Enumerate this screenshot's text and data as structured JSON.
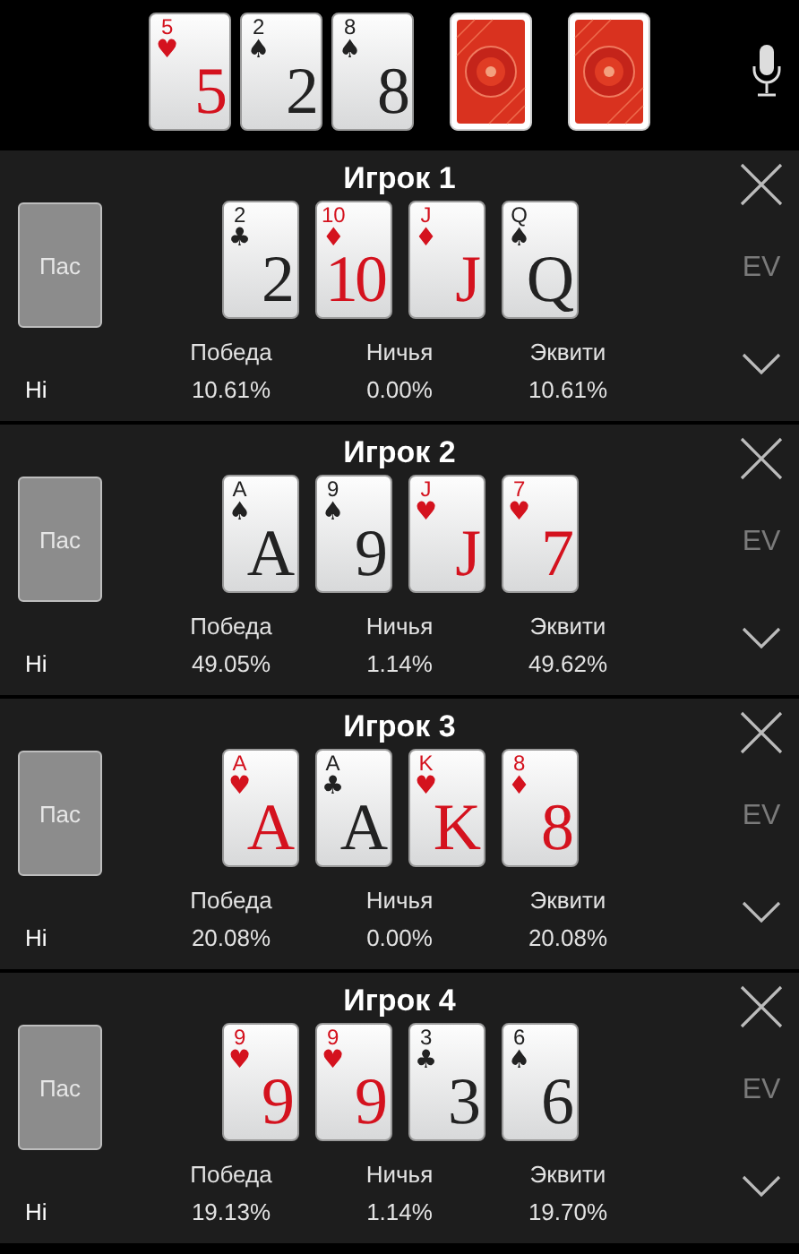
{
  "board": {
    "cards": [
      {
        "kind": "face",
        "corner": "5",
        "suit": "♥",
        "rank": "5",
        "color": "#d4121e"
      },
      {
        "kind": "face",
        "corner": "2",
        "suit": "♠",
        "rank": "2",
        "color": "#222222"
      },
      {
        "kind": "face",
        "corner": "8",
        "suit": "♠",
        "rank": "8",
        "color": "#222222"
      },
      {
        "kind": "back"
      },
      {
        "kind": "back"
      }
    ]
  },
  "players": [
    {
      "title": "Игрок 1",
      "fold": "Пас",
      "ev": "EV",
      "row_label": "Hi",
      "cards": [
        {
          "kind": "face",
          "corner": "2",
          "suit": "♣",
          "rank": "2",
          "color": "#222222"
        },
        {
          "kind": "face",
          "corner": "10",
          "suit": "♦",
          "rank": "10",
          "color": "#d4121e"
        },
        {
          "kind": "face",
          "corner": "J",
          "suit": "♦",
          "rank": "J",
          "color": "#d4121e"
        },
        {
          "kind": "face",
          "corner": "Q",
          "suit": "♠",
          "rank": "Q",
          "color": "#222222"
        }
      ],
      "stats": [
        {
          "label": "Победа",
          "value": "10.61%"
        },
        {
          "label": "Ничья",
          "value": "0.00%"
        },
        {
          "label": "Эквити",
          "value": "10.61%"
        }
      ]
    },
    {
      "title": "Игрок 2",
      "fold": "Пас",
      "ev": "EV",
      "row_label": "Hi",
      "cards": [
        {
          "kind": "face",
          "corner": "A",
          "suit": "♠",
          "rank": "A",
          "color": "#222222"
        },
        {
          "kind": "face",
          "corner": "9",
          "suit": "♠",
          "rank": "9",
          "color": "#222222"
        },
        {
          "kind": "face",
          "corner": "J",
          "suit": "♥",
          "rank": "J",
          "color": "#d4121e"
        },
        {
          "kind": "face",
          "corner": "7",
          "suit": "♥",
          "rank": "7",
          "color": "#d4121e"
        }
      ],
      "stats": [
        {
          "label": "Победа",
          "value": "49.05%"
        },
        {
          "label": "Ничья",
          "value": "1.14%"
        },
        {
          "label": "Эквити",
          "value": "49.62%"
        }
      ]
    },
    {
      "title": "Игрок 3",
      "fold": "Пас",
      "ev": "EV",
      "row_label": "Hi",
      "cards": [
        {
          "kind": "face",
          "corner": "A",
          "suit": "♥",
          "rank": "A",
          "color": "#d4121e"
        },
        {
          "kind": "face",
          "corner": "A",
          "suit": "♣",
          "rank": "A",
          "color": "#222222"
        },
        {
          "kind": "face",
          "corner": "K",
          "suit": "♥",
          "rank": "K",
          "color": "#d4121e"
        },
        {
          "kind": "face",
          "corner": "8",
          "suit": "♦",
          "rank": "8",
          "color": "#d4121e"
        }
      ],
      "stats": [
        {
          "label": "Победа",
          "value": "20.08%"
        },
        {
          "label": "Ничья",
          "value": "0.00%"
        },
        {
          "label": "Эквити",
          "value": "20.08%"
        }
      ]
    },
    {
      "title": "Игрок 4",
      "fold": "Пас",
      "ev": "EV",
      "row_label": "Hi",
      "cards": [
        {
          "kind": "face",
          "corner": "9",
          "suit": "♥",
          "rank": "9",
          "color": "#d4121e"
        },
        {
          "kind": "face",
          "corner": "9",
          "suit": "♥",
          "rank": "9",
          "color": "#d4121e"
        },
        {
          "kind": "face",
          "corner": "3",
          "suit": "♣",
          "rank": "3",
          "color": "#222222"
        },
        {
          "kind": "face",
          "corner": "6",
          "suit": "♠",
          "rank": "6",
          "color": "#222222"
        }
      ],
      "stats": [
        {
          "label": "Победа",
          "value": "19.13%"
        },
        {
          "label": "Ничья",
          "value": "1.14%"
        },
        {
          "label": "Эквити",
          "value": "19.70%"
        }
      ]
    }
  ]
}
